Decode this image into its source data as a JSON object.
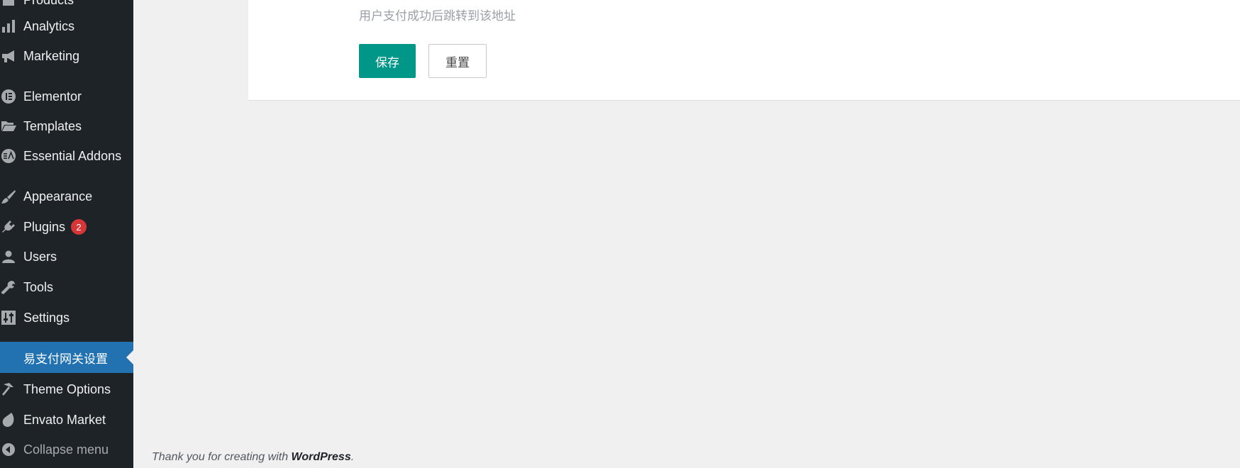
{
  "sidebar": {
    "items": [
      {
        "label": "Products",
        "icon": "products-icon"
      },
      {
        "label": "Analytics",
        "icon": "bar-chart-icon"
      },
      {
        "label": "Marketing",
        "icon": "megaphone-icon"
      },
      {
        "label": "Elementor",
        "icon": "elementor-icon"
      },
      {
        "label": "Templates",
        "icon": "folder-open-icon"
      },
      {
        "label": "Essential Addons",
        "icon": "essential-addons-icon"
      },
      {
        "label": "Appearance",
        "icon": "paint-brush-icon"
      },
      {
        "label": "Plugins",
        "icon": "plug-icon",
        "badge": "2"
      },
      {
        "label": "Users",
        "icon": "user-icon"
      },
      {
        "label": "Tools",
        "icon": "wrench-icon"
      },
      {
        "label": "Settings",
        "icon": "sliders-icon"
      },
      {
        "label": "易支付网关设置",
        "icon": "",
        "active": true
      },
      {
        "label": "Theme Options",
        "icon": "hammer-icon"
      },
      {
        "label": "Envato Market",
        "icon": "leaf-icon"
      },
      {
        "label": "Collapse menu",
        "icon": "collapse-arrow-icon"
      }
    ]
  },
  "form": {
    "hint": "用户支付成功后跳转到该地址",
    "save_label": "保存",
    "reset_label": "重置"
  },
  "footer": {
    "text_prefix": "Thank you for creating with ",
    "link": "WordPress",
    "suffix": "."
  },
  "colors": {
    "sidebar_bg": "#1d2327",
    "active_bg": "#2271b1",
    "save_button": "#009688",
    "badge": "#d63638"
  }
}
